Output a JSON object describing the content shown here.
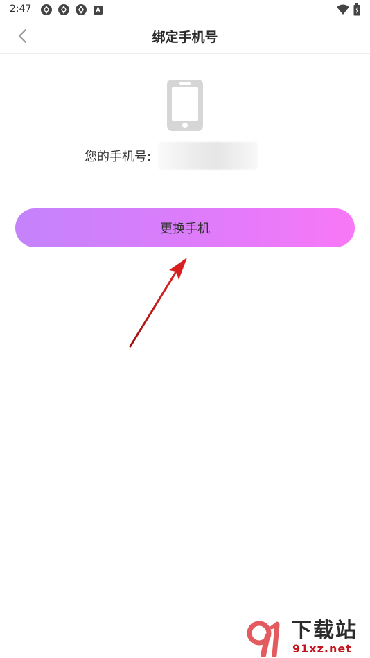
{
  "status_bar": {
    "time": "2:47",
    "icons_left": [
      "sync-icon",
      "sync-icon",
      "sync-icon",
      "app-a-icon"
    ],
    "icons_right": [
      "wifi-icon",
      "battery-icon"
    ]
  },
  "header": {
    "title": "绑定手机号",
    "back_icon": "chevron-left-icon"
  },
  "main": {
    "phone_icon": "smartphone-icon",
    "phone_label": "您的手机号:",
    "phone_value": "",
    "change_button_label": "更换手机"
  },
  "watermark": {
    "title": "下载站",
    "site": "91xz.net"
  },
  "colors": {
    "button_gradient_start": "#c483fb",
    "button_gradient_end": "#f878f7",
    "icon_gray": "#d6d6d6",
    "arrow_red": "#d81e1e",
    "watermark_red": "#c2161e"
  }
}
